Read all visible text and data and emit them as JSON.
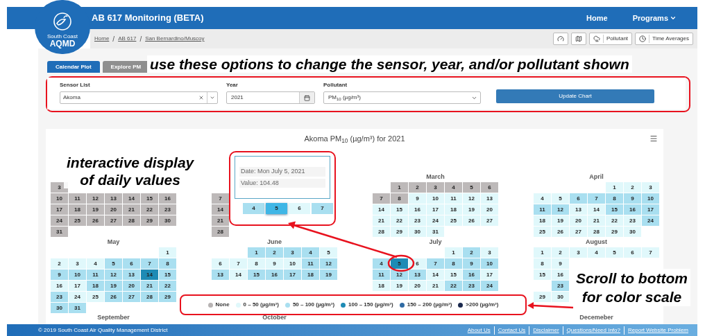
{
  "logo": {
    "line1": "South Coast",
    "line2": "AQMD"
  },
  "header": {
    "title": "AB 617 Monitoring  (BETA)",
    "nav": [
      {
        "label": "Home",
        "has_menu": false
      },
      {
        "label": "Programs",
        "has_menu": true
      }
    ]
  },
  "breadcrumb": [
    {
      "label": "Home"
    },
    {
      "separator": "/",
      "label": "AB 617"
    },
    {
      "separator": "/",
      "label": "San Bernardino/Muscoy"
    }
  ],
  "toolbar": [
    {
      "kind": "gauge"
    },
    {
      "kind": "map"
    },
    {
      "kind": "pollutant",
      "label": "Pollutant"
    },
    {
      "kind": "clock",
      "label": "Time Averages"
    }
  ],
  "tabs": [
    {
      "label": "Calendar Plot",
      "selected": true
    },
    {
      "label": "Explore PM",
      "selected": false
    }
  ],
  "options": {
    "sensor": {
      "label": "Sensor List",
      "value": "Akoma"
    },
    "year": {
      "label": "Year",
      "value": "2021"
    },
    "pollutant": {
      "label": "Pollutant",
      "value": "PM$_{10}$ (µg/m³)"
    },
    "button": "Update Chart"
  },
  "chart": {
    "title": "Akoma PM$_{10}$ (µg/m³) for 2021",
    "month_rows": [
      [
        {
          "weeks": [
            [
              {
                "kind": "blank"
              }
            ],
            [
              {
                "kind": "day",
                "day": "3",
                "color": "#bdb9b9"
              }
            ],
            [
              {
                "kind": "day",
                "day": "10",
                "color": "#bdb9b9"
              },
              {
                "kind": "day",
                "day": "11",
                "color": "#bdb9b9"
              },
              {
                "kind": "day",
                "day": "12",
                "color": "#bdb9b9"
              },
              {
                "kind": "day",
                "day": "13",
                "color": "#bdb9b9"
              },
              {
                "kind": "day",
                "day": "14",
                "color": "#bdb9b9"
              },
              {
                "kind": "day",
                "day": "15",
                "color": "#bdb9b9"
              },
              {
                "kind": "day",
                "day": "16",
                "color": "#bdb9b9"
              }
            ],
            [
              {
                "kind": "day",
                "day": "17",
                "color": "#bdb9b9"
              },
              {
                "kind": "day",
                "day": "18",
                "color": "#bdb9b9"
              },
              {
                "kind": "day",
                "day": "19",
                "color": "#bdb9b9"
              },
              {
                "kind": "day",
                "day": "20",
                "color": "#bdb9b9"
              },
              {
                "kind": "day",
                "day": "21",
                "color": "#bdb9b9"
              },
              {
                "kind": "day",
                "day": "22",
                "color": "#bdb9b9"
              },
              {
                "kind": "day",
                "day": "23",
                "color": "#bdb9b9"
              }
            ],
            [
              {
                "kind": "day",
                "day": "24",
                "color": "#bdb9b9"
              },
              {
                "kind": "day",
                "day": "25",
                "color": "#bdb9b9"
              },
              {
                "kind": "day",
                "day": "26",
                "color": "#bdb9b9"
              },
              {
                "kind": "day",
                "day": "27",
                "color": "#bdb9b9"
              },
              {
                "kind": "day",
                "day": "28",
                "color": "#bdb9b9"
              },
              {
                "kind": "day",
                "day": "29",
                "color": "#bdb9b9"
              },
              {
                "kind": "day",
                "day": "30",
                "color": "#bdb9b9"
              }
            ],
            [
              {
                "kind": "day",
                "day": "31",
                "color": "#bdb9b9"
              }
            ]
          ]
        },
        {
          "weeks": [
            [
              {
                "kind": "blank"
              }
            ],
            [
              {
                "kind": "day",
                "day": "7",
                "color": "#bdb9b9"
              }
            ],
            [
              {
                "kind": "day",
                "day": "14",
                "color": "#bdb9b9"
              }
            ],
            [
              {
                "kind": "day",
                "day": "21",
                "color": "#bdb9b9"
              }
            ],
            [
              {
                "kind": "day",
                "day": "28",
                "color": "#bdb9b9"
              }
            ]
          ]
        },
        {
          "title": "March",
          "weeks": [
            [
              {
                "kind": "blank"
              },
              {
                "kind": "day",
                "day": "1",
                "color": "#bdb9b9"
              },
              {
                "kind": "day",
                "day": "2",
                "color": "#bdb9b9"
              },
              {
                "kind": "day",
                "day": "3",
                "color": "#bdb9b9"
              },
              {
                "kind": "day",
                "day": "4",
                "color": "#bdb9b9"
              },
              {
                "kind": "day",
                "day": "5",
                "color": "#bdb9b9"
              },
              {
                "kind": "day",
                "day": "6",
                "color": "#bdb9b9"
              }
            ],
            [
              {
                "kind": "day",
                "day": "7",
                "color": "#bdb9b9"
              },
              {
                "kind": "day",
                "day": "8",
                "color": "#bdb9b9"
              },
              {
                "kind": "day",
                "day": "9",
                "color": "#e0f8fb"
              },
              {
                "kind": "day",
                "day": "10",
                "color": "#e0f8fb"
              },
              {
                "kind": "day",
                "day": "11",
                "color": "#e0f8fb"
              },
              {
                "kind": "day",
                "day": "12",
                "color": "#e0f8fb"
              },
              {
                "kind": "day",
                "day": "13",
                "color": "#e0f8fb"
              }
            ],
            [
              {
                "kind": "day",
                "day": "14",
                "color": "#e0f8fb"
              },
              {
                "kind": "day",
                "day": "15",
                "color": "#e0f8fb"
              },
              {
                "kind": "day",
                "day": "16",
                "color": "#e0f8fb"
              },
              {
                "kind": "day",
                "day": "17",
                "color": "#e0f8fb"
              },
              {
                "kind": "day",
                "day": "18",
                "color": "#e0f8fb"
              },
              {
                "kind": "day",
                "day": "19",
                "color": "#e0f8fb"
              },
              {
                "kind": "day",
                "day": "20",
                "color": "#e0f8fb"
              }
            ],
            [
              {
                "kind": "day",
                "day": "21",
                "color": "#e0f8fb"
              },
              {
                "kind": "day",
                "day": "22",
                "color": "#e0f8fb"
              },
              {
                "kind": "day",
                "day": "23",
                "color": "#e0f8fb"
              },
              {
                "kind": "day",
                "day": "24",
                "color": "#e0f8fb"
              },
              {
                "kind": "day",
                "day": "25",
                "color": "#e0f8fb"
              },
              {
                "kind": "day",
                "day": "26",
                "color": "#e0f8fb"
              },
              {
                "kind": "day",
                "day": "27",
                "color": "#e0f8fb"
              }
            ],
            [
              {
                "kind": "day",
                "day": "28",
                "color": "#e0f8fb"
              },
              {
                "kind": "day",
                "day": "29",
                "color": "#e0f8fb"
              },
              {
                "kind": "day",
                "day": "30",
                "color": "#e0f8fb"
              },
              {
                "kind": "day",
                "day": "31",
                "color": "#e0f8fb"
              }
            ]
          ]
        },
        {
          "title": "April",
          "weeks": [
            [
              {
                "kind": "blank"
              },
              {
                "kind": "blank"
              },
              {
                "kind": "blank"
              },
              {
                "kind": "blank"
              },
              {
                "kind": "day",
                "day": "1",
                "color": "#e0f8fb"
              },
              {
                "kind": "day",
                "day": "2",
                "color": "#e0f8fb"
              },
              {
                "kind": "day",
                "day": "3",
                "color": "#e0f8fb"
              }
            ],
            [
              {
                "kind": "day",
                "day": "4",
                "color": "#e0f8fb"
              },
              {
                "kind": "day",
                "day": "5",
                "color": "#e0f8fb"
              },
              {
                "kind": "day",
                "day": "6",
                "color": "#a9dff0"
              },
              {
                "kind": "day",
                "day": "7",
                "color": "#a9dff0"
              },
              {
                "kind": "day",
                "day": "8",
                "color": "#a9dff0"
              },
              {
                "kind": "day",
                "day": "9",
                "color": "#a9dff0"
              },
              {
                "kind": "day",
                "day": "10",
                "color": "#a9dff0"
              }
            ],
            [
              {
                "kind": "day",
                "day": "11",
                "color": "#a9dff0"
              },
              {
                "kind": "day",
                "day": "12",
                "color": "#a9dff0"
              },
              {
                "kind": "day",
                "day": "13",
                "color": "#e0f8fb"
              },
              {
                "kind": "day",
                "day": "14",
                "color": "#e0f8fb"
              },
              {
                "kind": "day",
                "day": "15",
                "color": "#a9dff0"
              },
              {
                "kind": "day",
                "day": "16",
                "color": "#a9dff0"
              },
              {
                "kind": "day",
                "day": "17",
                "color": "#a9dff0"
              }
            ],
            [
              {
                "kind": "day",
                "day": "18",
                "color": "#e0f8fb"
              },
              {
                "kind": "day",
                "day": "19",
                "color": "#e0f8fb"
              },
              {
                "kind": "day",
                "day": "20",
                "color": "#e0f8fb"
              },
              {
                "kind": "day",
                "day": "21",
                "color": "#e0f8fb"
              },
              {
                "kind": "day",
                "day": "22",
                "color": "#e0f8fb"
              },
              {
                "kind": "day",
                "day": "23",
                "color": "#e0f8fb"
              },
              {
                "kind": "day",
                "day": "24",
                "color": "#a9dff0"
              }
            ],
            [
              {
                "kind": "day",
                "day": "25",
                "color": "#e0f8fb"
              },
              {
                "kind": "day",
                "day": "26",
                "color": "#e0f8fb"
              },
              {
                "kind": "day",
                "day": "27",
                "color": "#e0f8fb"
              },
              {
                "kind": "day",
                "day": "28",
                "color": "#e0f8fb"
              },
              {
                "kind": "day",
                "day": "29",
                "color": "#e0f8fb"
              },
              {
                "kind": "day",
                "day": "30",
                "color": "#e0f8fb"
              }
            ]
          ]
        }
      ],
      [
        {
          "title": "May",
          "weeks": [
            [
              {
                "kind": "blank"
              },
              {
                "kind": "blank"
              },
              {
                "kind": "blank"
              },
              {
                "kind": "blank"
              },
              {
                "kind": "blank"
              },
              {
                "kind": "blank"
              },
              {
                "kind": "day",
                "day": "1",
                "color": "#e0f8fb"
              }
            ],
            [
              {
                "kind": "day",
                "day": "2",
                "color": "#e0f8fb"
              },
              {
                "kind": "day",
                "day": "3",
                "color": "#e0f8fb"
              },
              {
                "kind": "day",
                "day": "4",
                "color": "#e0f8fb"
              },
              {
                "kind": "day",
                "day": "5",
                "color": "#a9dff0"
              },
              {
                "kind": "day",
                "day": "6",
                "color": "#a9dff0"
              },
              {
                "kind": "day",
                "day": "7",
                "color": "#a9dff0"
              },
              {
                "kind": "day",
                "day": "8",
                "color": "#a9dff0"
              }
            ],
            [
              {
                "kind": "day",
                "day": "9",
                "color": "#a9dff0"
              },
              {
                "kind": "day",
                "day": "10",
                "color": "#a9dff0"
              },
              {
                "kind": "day",
                "day": "11",
                "color": "#a9dff0"
              },
              {
                "kind": "day",
                "day": "12",
                "color": "#a9dff0"
              },
              {
                "kind": "day",
                "day": "13",
                "color": "#a9dff0"
              },
              {
                "kind": "day",
                "day": "14",
                "color": "#1e8bb5"
              },
              {
                "kind": "day",
                "day": "15",
                "color": "#a9dff0"
              }
            ],
            [
              {
                "kind": "day",
                "day": "16",
                "color": "#e0f8fb"
              },
              {
                "kind": "day",
                "day": "17",
                "color": "#e0f8fb"
              },
              {
                "kind": "day",
                "day": "18",
                "color": "#a9dff0"
              },
              {
                "kind": "day",
                "day": "19",
                "color": "#a9dff0"
              },
              {
                "kind": "day",
                "day": "20",
                "color": "#a9dff0"
              },
              {
                "kind": "day",
                "day": "21",
                "color": "#a9dff0"
              },
              {
                "kind": "day",
                "day": "22",
                "color": "#a9dff0"
              }
            ],
            [
              {
                "kind": "day",
                "day": "23",
                "color": "#a9dff0"
              },
              {
                "kind": "day",
                "day": "24",
                "color": "#e0f8fb"
              },
              {
                "kind": "day",
                "day": "25",
                "color": "#e0f8fb"
              },
              {
                "kind": "day",
                "day": "26",
                "color": "#a9dff0"
              },
              {
                "kind": "day",
                "day": "27",
                "color": "#a9dff0"
              },
              {
                "kind": "day",
                "day": "28",
                "color": "#a9dff0"
              },
              {
                "kind": "day",
                "day": "29",
                "color": "#a9dff0"
              }
            ],
            [
              {
                "kind": "day",
                "day": "30",
                "color": "#a9dff0"
              },
              {
                "kind": "day",
                "day": "31",
                "color": "#a9dff0"
              }
            ]
          ]
        },
        {
          "title": "June",
          "weeks": [
            [
              {
                "kind": "blank"
              },
              {
                "kind": "blank"
              },
              {
                "kind": "day",
                "day": "1",
                "color": "#a9dff0"
              },
              {
                "kind": "day",
                "day": "2",
                "color": "#a9dff0"
              },
              {
                "kind": "day",
                "day": "3",
                "color": "#a9dff0"
              },
              {
                "kind": "day",
                "day": "4",
                "color": "#a9dff0"
              },
              {
                "kind": "day",
                "day": "5",
                "color": "#e0f8fb"
              }
            ],
            [
              {
                "kind": "day",
                "day": "6",
                "color": "#e0f8fb"
              },
              {
                "kind": "day",
                "day": "7",
                "color": "#e0f8fb"
              },
              {
                "kind": "day",
                "day": "8",
                "color": "#e0f8fb"
              },
              {
                "kind": "day",
                "day": "9",
                "color": "#e0f8fb"
              },
              {
                "kind": "day",
                "day": "10",
                "color": "#e0f8fb"
              },
              {
                "kind": "day",
                "day": "11",
                "color": "#a9dff0"
              },
              {
                "kind": "day",
                "day": "12",
                "color": "#a9dff0"
              }
            ],
            [
              {
                "kind": "day",
                "day": "13",
                "color": "#a9dff0"
              },
              {
                "kind": "day",
                "day": "14",
                "color": "#e0f8fb"
              },
              {
                "kind": "day",
                "day": "15",
                "color": "#a9dff0"
              },
              {
                "kind": "day",
                "day": "16",
                "color": "#a9dff0"
              },
              {
                "kind": "day",
                "day": "17",
                "color": "#a9dff0"
              },
              {
                "kind": "day",
                "day": "18",
                "color": "#a9dff0"
              },
              {
                "kind": "day",
                "day": "19",
                "color": "#a9dff0"
              }
            ]
          ]
        },
        {
          "title": "July",
          "weeks": [
            [
              {
                "kind": "blank"
              },
              {
                "kind": "blank"
              },
              {
                "kind": "blank"
              },
              {
                "kind": "blank"
              },
              {
                "kind": "day",
                "day": "1",
                "color": "#e0f8fb"
              },
              {
                "kind": "day",
                "day": "2",
                "color": "#a9dff0"
              },
              {
                "kind": "day",
                "day": "3",
                "color": "#e0f8fb"
              }
            ],
            [
              {
                "kind": "day",
                "day": "4",
                "color": "#a9dff0"
              },
              {
                "kind": "day",
                "day": "5",
                "color": "#1e8bb5"
              },
              {
                "kind": "day",
                "day": "6",
                "color": "#e0f8fb"
              },
              {
                "kind": "day",
                "day": "7",
                "color": "#a9dff0"
              },
              {
                "kind": "day",
                "day": "8",
                "color": "#a9dff0"
              },
              {
                "kind": "day",
                "day": "9",
                "color": "#a9dff0"
              },
              {
                "kind": "day",
                "day": "10",
                "color": "#a9dff0"
              }
            ],
            [
              {
                "kind": "day",
                "day": "11",
                "color": "#a9dff0"
              },
              {
                "kind": "day",
                "day": "12",
                "color": "#a9dff0"
              },
              {
                "kind": "day",
                "day": "13",
                "color": "#a9dff0"
              },
              {
                "kind": "day",
                "day": "14",
                "color": "#e0f8fb"
              },
              {
                "kind": "day",
                "day": "15",
                "color": "#e0f8fb"
              },
              {
                "kind": "day",
                "day": "16",
                "color": "#a9dff0"
              },
              {
                "kind": "day",
                "day": "17",
                "color": "#e0f8fb"
              }
            ],
            [
              {
                "kind": "day",
                "day": "18",
                "color": "#e0f8fb"
              },
              {
                "kind": "day",
                "day": "19",
                "color": "#e0f8fb"
              },
              {
                "kind": "day",
                "day": "20",
                "color": "#e0f8fb"
              },
              {
                "kind": "day",
                "day": "21",
                "color": "#e0f8fb"
              },
              {
                "kind": "day",
                "day": "22",
                "color": "#a9dff0"
              },
              {
                "kind": "day",
                "day": "23",
                "color": "#a9dff0"
              },
              {
                "kind": "day",
                "day": "24",
                "color": "#a9dff0"
              }
            ]
          ]
        },
        {
          "title": "August",
          "weeks": [
            [
              {
                "kind": "day",
                "day": "1",
                "color": "#e0f8fb"
              },
              {
                "kind": "day",
                "day": "2",
                "color": "#e0f8fb"
              },
              {
                "kind": "day",
                "day": "3",
                "color": "#e0f8fb"
              },
              {
                "kind": "day",
                "day": "4",
                "color": "#e0f8fb"
              },
              {
                "kind": "day",
                "day": "5",
                "color": "#e0f8fb"
              },
              {
                "kind": "day",
                "day": "6",
                "color": "#e0f8fb"
              },
              {
                "kind": "day",
                "day": "7",
                "color": "#e0f8fb"
              }
            ],
            [
              {
                "kind": "day",
                "day": "8",
                "color": "#e0f8fb"
              },
              {
                "kind": "day",
                "day": "9",
                "color": "#e0f8fb"
              }
            ],
            [
              {
                "kind": "day",
                "day": "15",
                "color": "#e0f8fb"
              },
              {
                "kind": "day",
                "day": "16",
                "color": "#e0f8fb"
              }
            ],
            [
              {
                "kind": "blank"
              },
              {
                "kind": "day",
                "day": "23",
                "color": "#a9dff0"
              }
            ],
            [
              {
                "kind": "day",
                "day": "29",
                "color": "#e0f8fb"
              },
              {
                "kind": "day",
                "day": "30",
                "color": "#e0f8fb"
              }
            ]
          ]
        }
      ],
      [
        {
          "title": "September"
        },
        {
          "title": "October"
        },
        {
          "title": "Decemeber"
        }
      ]
    ],
    "tooltip": {
      "date": "Date: Mon July 5, 2021",
      "value": "Value: 104.48",
      "cells": [
        {
          "day": "4",
          "color": "#a9dff0",
          "hovered": false
        },
        {
          "day": "5",
          "color": "#3fb6e6",
          "hovered": true
        },
        {
          "day": "6",
          "color": "#e0f8fb",
          "hovered": false
        },
        {
          "day": "7",
          "color": "#a9dff0",
          "hovered": false
        }
      ]
    },
    "legend": [
      {
        "label": "None",
        "color": "#b7b3b3"
      },
      {
        "label": "0 – 50 (µg/m³)",
        "color": "#e0f8fb"
      },
      {
        "label": "50 – 100 (µg/m³)",
        "color": "#a9dff0"
      },
      {
        "label": "100 – 150 (µg/m³)",
        "color": "#1e8bb5"
      },
      {
        "label": "150 – 200 (µg/m³)",
        "color": "#2f6aa3"
      },
      {
        "label": ">200 (µg/m³)",
        "color": "#1b2a4e"
      }
    ]
  },
  "annotations": {
    "options_note": "use these options to change the sensor, year, and/or pollutant shown",
    "tooltip_note": [
      "interactive display",
      "of daily values"
    ],
    "legend_note": [
      "Scroll to bottom",
      "for color scale"
    ]
  },
  "footer": {
    "copyright": "© 2019 South Coast Air Quality Management District",
    "links": [
      "About Us",
      "Contact Us",
      "Disclaimer",
      "Questions/Need Info?",
      "Report Website Problem"
    ]
  }
}
